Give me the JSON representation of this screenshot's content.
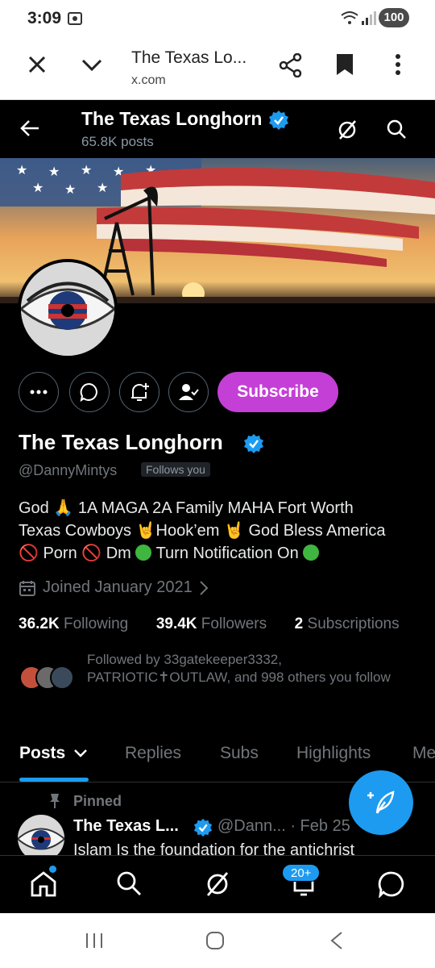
{
  "statusbar": {
    "time": "3:09",
    "battery": "100",
    "network": "5"
  },
  "browser_tab": {
    "title": "The Texas Lo...",
    "url": "x.com"
  },
  "header": {
    "name": "The Texas Longhorn",
    "posts_count": "65.8K posts"
  },
  "profile": {
    "name": "The Texas Longhorn",
    "handle": "@DannyMintys",
    "follows_you": "Follows you",
    "subscribe_label": "Subscribe",
    "bio_line1": "God 🙏 1A MAGA 2A Family MAHA  Fort Worth",
    "bio_line2": "Texas Cowboys 🤘Hook’em 🤘 God Bless America",
    "bio_line3_a": "🚫 Porn  🚫 Dm ",
    "bio_line3_b": " Turn Notification On ",
    "joined": "Joined January 2021",
    "following_count": "36.2K",
    "following_label": "Following",
    "followers_count": "39.4K",
    "followers_label": "Followers",
    "subs_count": "2",
    "subs_label": "Subscriptions",
    "followed_by": "Followed by 33gatekeeper3332, PATRIOTIC✝OUTLAW, and 998 others you follow"
  },
  "tabs": [
    {
      "label": "Posts"
    },
    {
      "label": "Replies"
    },
    {
      "label": "Subs"
    },
    {
      "label": "Highlights"
    },
    {
      "label": "Me"
    }
  ],
  "pinned_post": {
    "pinned_label": "Pinned",
    "author": "The Texas L...",
    "meta": "@Dann... · Feb 25",
    "text": "Islam Is the foundation for the antichrist"
  },
  "bottom_nav": {
    "notifications_badge": "20+"
  },
  "colors": {
    "accent": "#1d9bf0",
    "subscribe": "#c43fd6",
    "background": "#000000"
  }
}
